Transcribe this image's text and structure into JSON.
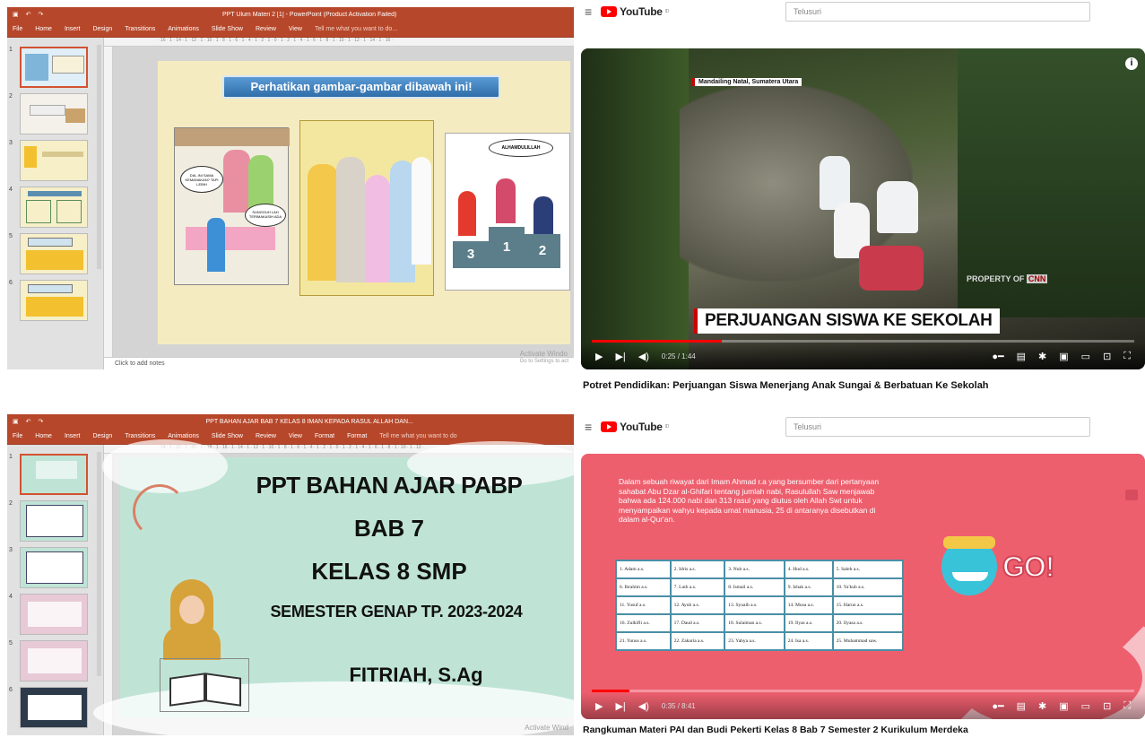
{
  "ppt1": {
    "titlebar": "PPT Ulum Materi 2 [1] - PowerPoint (Product Activation Failed)",
    "menu": [
      "File",
      "Home",
      "Insert",
      "Design",
      "Transitions",
      "Animations",
      "Slide Show",
      "Review",
      "View"
    ],
    "tell": "Tell me what you want to do...",
    "thumb_numbers": [
      "1",
      "2",
      "3",
      "4",
      "5",
      "6"
    ],
    "slide_banner": "Perhatikan gambar-gambar dibawah ini!",
    "bubble_1": "DIA..INI SAMA KEMANAKAN? TAPI LEBIH",
    "bubble_2": "SUNGGUH LAH TERIMAKASIH ADA",
    "bubble_3": "ALHAMDULILLAH",
    "podium": [
      "3",
      "1",
      "2"
    ],
    "notes": "Click to add notes",
    "watermark": [
      "Activate Windo",
      "Go to Settings to act"
    ]
  },
  "yt1": {
    "search_placeholder": "Telusuri",
    "location": "Mandailing Natal, Sumatera Utara",
    "property": "PROPERTY OF",
    "cnn": "CNN",
    "caption": "PERJUANGAN SISWA KE SEKOLAH",
    "time": "0:25 / 1:44",
    "progress": 0.24,
    "title": "Potret Pendidikan: Perjuangan Siswa Menerjang Anak Sungai & Berbatuan Ke Sekolah"
  },
  "ppt2": {
    "titlebar": "PPT BAHAN AJAR BAB 7 KELAS 8 IMAN KEPADA RASUL ALLAH DAN...",
    "menu": [
      "File",
      "Home",
      "Insert",
      "Design",
      "Transitions",
      "Animations",
      "Slide Show",
      "Review",
      "View",
      "Format",
      "Format"
    ],
    "tell": "Tell me what you want to do",
    "thumb_numbers": [
      "1",
      "2",
      "3",
      "4",
      "5",
      "6"
    ],
    "slide_lines": [
      "PPT BAHAN AJAR PABP",
      "BAB 7",
      "KELAS 8 SMP",
      "SEMESTER GENAP TP. 2023-2024",
      "FITRIAH, S.Ag"
    ],
    "watermark": "Activate Wind"
  },
  "yt2": {
    "search_placeholder": "Telusuri",
    "paragraph": "Dalam sebuah riwayat dari Imam Ahmad r.a yang bersumber dari pertanyaan sahabat Abu Dzar al-Ghifari tentang jumlah nabi, Rasulullah Saw menjawab bahwa ada 124.000 nabi dan 313 rasul yang diutus oleh Allah Swt untuk menyampaikan wahyu kepada umat manusia, 25 di antaranya disebutkan di dalam al-Qur'an.",
    "table": [
      [
        "1. Adam a.s.",
        "2. Idris a.s.",
        "3. Nuh a.s.",
        "4. Hud a.s.",
        "5. Saleh a.s."
      ],
      [
        "6. Ibrahim a.s.",
        "7. Luth a.s.",
        "8. Ismail a.s.",
        "9. Ishak a.s.",
        "10. Ya'kub a.s."
      ],
      [
        "11. Yusuf a.s.",
        "12. Ayub a.s.",
        "13. Syuaib a.s.",
        "14. Musa a.s.",
        "15. Harun a.s."
      ],
      [
        "16. Zulkifli a.s.",
        "17. Daud a.s.",
        "18. Sulaiman a.s.",
        "19. Ilyas a.s.",
        "20. Ilyasa a.s."
      ],
      [
        "21. Yunus a.s.",
        "22. Zakaria a.s.",
        "23. Yahya a.s.",
        "24. Isa a.s.",
        "25. Muhammad saw."
      ]
    ],
    "go": "GO!",
    "time": "0:35 / 8:41",
    "progress": 0.07,
    "title": "Rangkuman Materi PAI dan Budi Pekerti Kelas 8 Bab 7 Semester 2 Kurikulum Merdeka"
  },
  "colors": {
    "ppt_red": "#b7472a",
    "yt_red": "#ff0000",
    "slide2_bg": "#bfe4d6",
    "video2_bg": "#ee5f6e"
  }
}
